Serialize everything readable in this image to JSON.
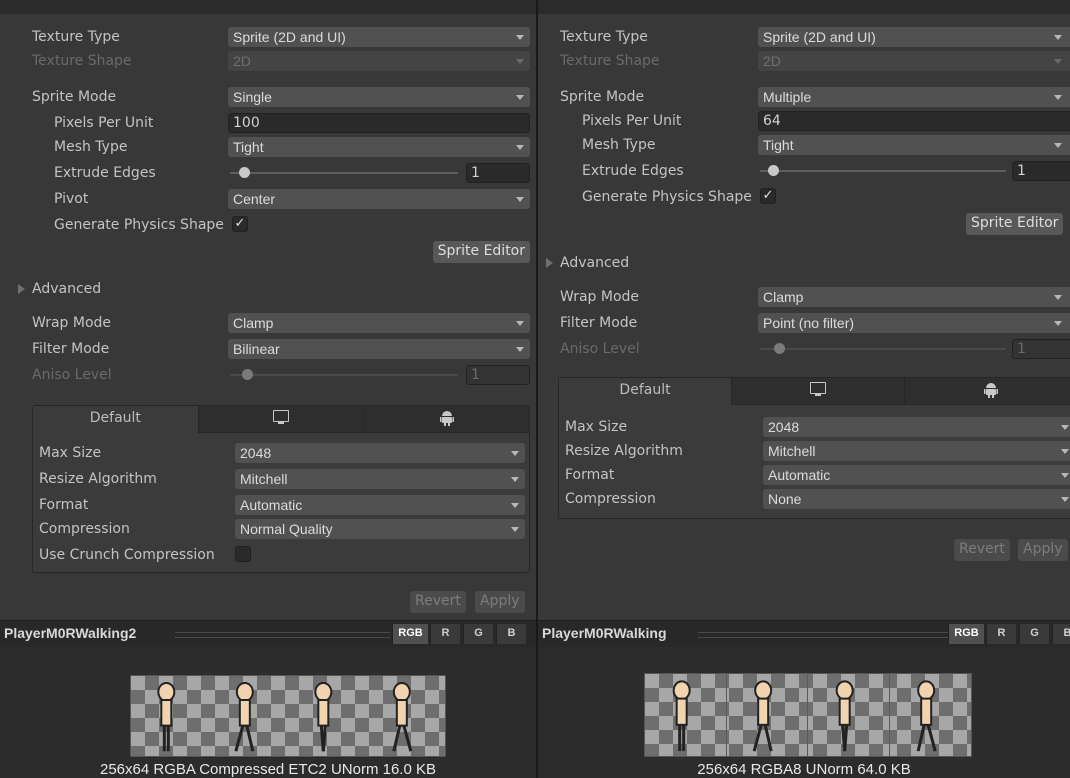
{
  "colors": {
    "background": "#383838",
    "field": "#515151",
    "preview_bg": "#2c2c2c"
  },
  "inspectors": [
    {
      "texture_type_label": "Texture Type",
      "texture_type_value": "Sprite (2D and UI)",
      "texture_shape_label": "Texture Shape",
      "texture_shape_value": "2D",
      "sprite_mode_label": "Sprite Mode",
      "sprite_mode_value": "Single",
      "ppu_label": "Pixels Per Unit",
      "ppu_value": "100",
      "mesh_type_label": "Mesh Type",
      "mesh_type_value": "Tight",
      "extrude_label": "Extrude Edges",
      "extrude_value": "1",
      "extrude_slider_fraction": 0.03,
      "pivot_label": "Pivot",
      "pivot_value": "Center",
      "physics_label": "Generate Physics Shape",
      "physics_checked": true,
      "check_mark": "✓",
      "sprite_editor_label": "Sprite Editor",
      "advanced_label": "Advanced",
      "wrap_label": "Wrap Mode",
      "wrap_value": "Clamp",
      "filter_label": "Filter Mode",
      "filter_value": "Bilinear",
      "aniso_label": "Aniso Level",
      "aniso_value": "1",
      "aniso_slider_fraction": 0.06,
      "tab_default": "Default",
      "tab_standalone_icon": "monitor-icon",
      "tab_android_icon": "android-icon",
      "max_size_label": "Max Size",
      "max_size_value": "2048",
      "resize_label": "Resize Algorithm",
      "resize_value": "Mitchell",
      "format_label": "Format",
      "format_value": "Automatic",
      "compression_label": "Compression",
      "compression_value": "Normal Quality",
      "crunch_label": "Use Crunch Compression",
      "crunch_checked": false,
      "revert_label": "Revert",
      "apply_label": "Apply",
      "preview_title": "PlayerM0RWalking2",
      "channels": [
        "RGB",
        "R",
        "G",
        "B"
      ],
      "caption": "256x64  RGBA Compressed ETC2 UNorm  16.0 KB"
    },
    {
      "texture_type_label": "Texture Type",
      "texture_type_value": "Sprite (2D and UI)",
      "texture_shape_label": "Texture Shape",
      "texture_shape_value": "2D",
      "sprite_mode_label": "Sprite Mode",
      "sprite_mode_value": "Multiple",
      "ppu_label": "Pixels Per Unit",
      "ppu_value": "64",
      "mesh_type_label": "Mesh Type",
      "mesh_type_value": "Tight",
      "extrude_label": "Extrude Edges",
      "extrude_value": "1",
      "extrude_slider_fraction": 0.03,
      "physics_label": "Generate Physics Shape",
      "physics_checked": true,
      "check_mark": "✓",
      "sprite_editor_label": "Sprite Editor",
      "advanced_label": "Advanced",
      "wrap_label": "Wrap Mode",
      "wrap_value": "Clamp",
      "filter_label": "Filter Mode",
      "filter_value": "Point (no filter)",
      "aniso_label": "Aniso Level",
      "aniso_value": "1",
      "aniso_slider_fraction": 0.06,
      "tab_default": "Default",
      "tab_standalone_icon": "monitor-icon",
      "tab_android_icon": "android-icon",
      "max_size_label": "Max Size",
      "max_size_value": "2048",
      "resize_label": "Resize Algorithm",
      "resize_value": "Mitchell",
      "format_label": "Format",
      "format_value": "Automatic",
      "compression_label": "Compression",
      "compression_value": "None",
      "revert_label": "Revert",
      "apply_label": "Apply",
      "preview_title": "PlayerM0RWalking",
      "channels": [
        "RGB",
        "R",
        "G",
        "B"
      ],
      "caption": "256x64  RGBA8 UNorm  64.0 KB"
    }
  ]
}
